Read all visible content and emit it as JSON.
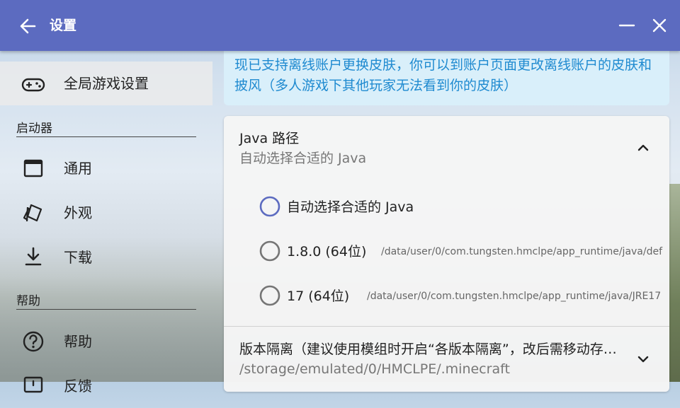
{
  "appbar": {
    "title": "设置",
    "color": "#5c6bc0"
  },
  "sidebar": {
    "global_item": {
      "label": "全局游戏设置",
      "icon": "gamepad-icon"
    },
    "sections": [
      {
        "title": "启动器",
        "items": [
          {
            "label": "通用",
            "icon": "window-icon"
          },
          {
            "label": "外观",
            "icon": "cards-icon"
          },
          {
            "label": "下载",
            "icon": "download-icon"
          }
        ]
      },
      {
        "title": "帮助",
        "items": [
          {
            "label": "帮助",
            "icon": "help-circle-icon"
          },
          {
            "label": "反馈",
            "icon": "feedback-icon"
          }
        ]
      }
    ]
  },
  "notice": {
    "text": "现已支持离线账户更换皮肤，你可以到账户页面更改离线账户的皮肤和披风（多人游戏下其他玩家无法看到你的皮肤）",
    "color": "#1f8ad0"
  },
  "java_setting": {
    "title": "Java 路径",
    "subtitle": "自动选择合适的 Java",
    "expanded": true,
    "options": [
      {
        "label": "自动选择合适的 Java",
        "path": "",
        "selected": true
      },
      {
        "label": "1.8.0 (64位)",
        "path": "/data/user/0/com.tungsten.hmclpe/app_runtime/java/def",
        "selected": false
      },
      {
        "label": "17 (64位)",
        "path": "/data/user/0/com.tungsten.hmclpe/app_runtime/java/JRE17",
        "selected": false
      }
    ]
  },
  "isolation_setting": {
    "title": "版本隔离（建议使用模组时开启“各版本隔离”，改后需移动存…",
    "subtitle": "/storage/emulated/0/HMCLPE/.minecraft"
  },
  "colors": {
    "accent": "#5c6bc0",
    "radio_unselected": "#757575"
  }
}
